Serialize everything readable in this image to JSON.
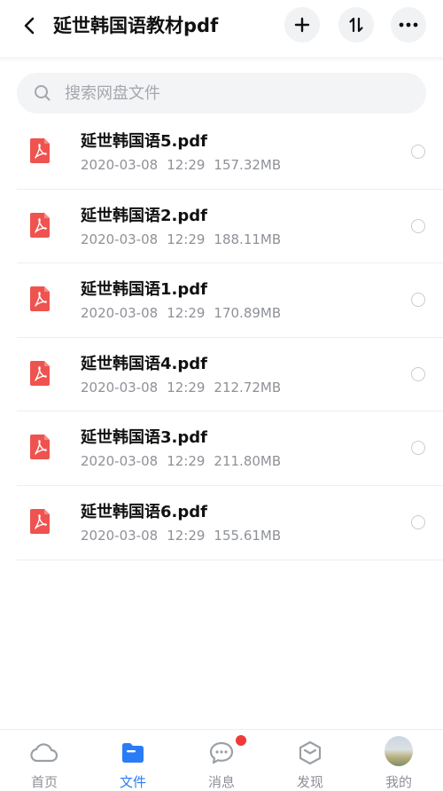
{
  "header": {
    "title": "延世韩国语教材pdf",
    "back_icon": "chevron-left-icon",
    "actions": [
      "plus-icon",
      "sort-icon",
      "more-icon"
    ]
  },
  "search": {
    "placeholder": "搜索网盘文件"
  },
  "files": [
    {
      "name": "延世韩国语5.pdf",
      "date": "2020-03-08",
      "time": "12:29",
      "size": "157.32MB"
    },
    {
      "name": "延世韩国语2.pdf",
      "date": "2020-03-08",
      "time": "12:29",
      "size": "188.11MB"
    },
    {
      "name": "延世韩国语1.pdf",
      "date": "2020-03-08",
      "time": "12:29",
      "size": "170.89MB"
    },
    {
      "name": "延世韩国语4.pdf",
      "date": "2020-03-08",
      "time": "12:29",
      "size": "212.72MB"
    },
    {
      "name": "延世韩国语3.pdf",
      "date": "2020-03-08",
      "time": "12:29",
      "size": "211.80MB"
    },
    {
      "name": "延世韩国语6.pdf",
      "date": "2020-03-08",
      "time": "12:29",
      "size": "155.61MB"
    }
  ],
  "tabbar": {
    "tabs": [
      {
        "label": "首页",
        "icon": "cloud-icon"
      },
      {
        "label": "文件",
        "icon": "folder-icon",
        "active": true
      },
      {
        "label": "消息",
        "icon": "chat-icon",
        "badge": true
      },
      {
        "label": "发现",
        "icon": "cube-icon"
      },
      {
        "label": "我的",
        "icon": "avatar"
      }
    ]
  },
  "colors": {
    "accent": "#2a7cf6",
    "pdf": "#ef5350",
    "badge": "#f03a3a"
  }
}
